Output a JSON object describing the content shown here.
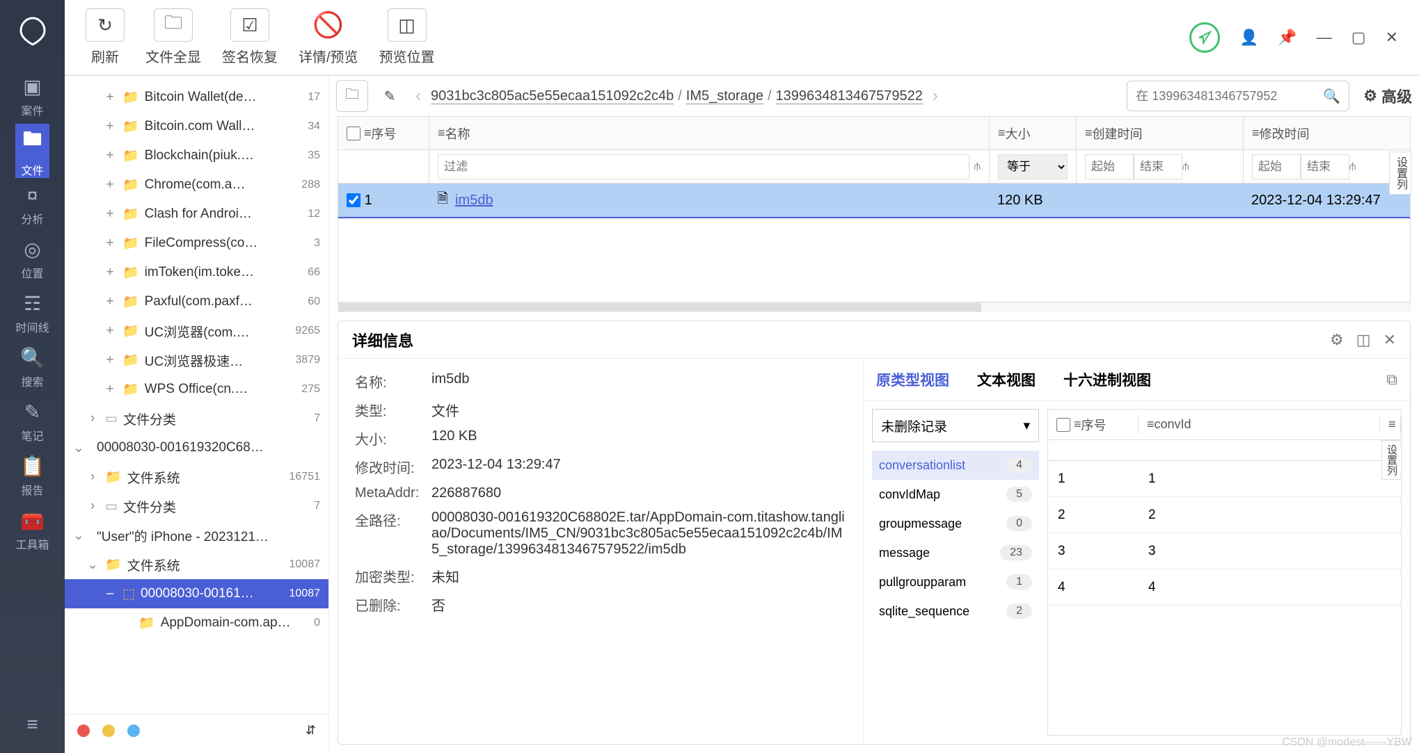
{
  "leftNav": {
    "items": [
      {
        "icon": "▣",
        "label": "案件"
      },
      {
        "icon": "🖿",
        "label": "文件"
      },
      {
        "icon": "¤",
        "label": "分析"
      },
      {
        "icon": "◎",
        "label": "位置"
      },
      {
        "icon": "☶",
        "label": "时间线"
      },
      {
        "icon": "🔍",
        "label": "搜索"
      },
      {
        "icon": "✎",
        "label": "笔记"
      },
      {
        "icon": "📋",
        "label": "报告"
      },
      {
        "icon": "🧰",
        "label": "工具箱"
      }
    ],
    "activeIndex": 1
  },
  "toolbar": {
    "items": [
      {
        "icon": "↻",
        "label": "刷新"
      },
      {
        "icon": "🗀",
        "label": "文件全显"
      },
      {
        "icon": "☑",
        "label": "签名恢复"
      },
      {
        "icon": "🚫",
        "label": "详情/预览",
        "noborder": true
      },
      {
        "icon": "◫",
        "label": "预览位置"
      }
    ]
  },
  "breadcrumb": {
    "segments": [
      "9031bc3c805ac5e55ecaa151092c2c4b",
      "IM5_storage",
      "1399634813467579522"
    ],
    "searchPlaceholder": "在 139963481346757952",
    "advanced": "高级"
  },
  "tree": {
    "items": [
      {
        "lvl": 2,
        "exp": "+",
        "icon": "📁",
        "name": "Bitcoin Wallet(de…",
        "count": "17"
      },
      {
        "lvl": 2,
        "exp": "+",
        "icon": "📁",
        "name": "Bitcoin.com Wall…",
        "count": "34"
      },
      {
        "lvl": 2,
        "exp": "+",
        "icon": "📁",
        "name": "Blockchain(piuk.…",
        "count": "35"
      },
      {
        "lvl": 2,
        "exp": "+",
        "icon": "📁",
        "name": "Chrome(com.a…",
        "count": "288"
      },
      {
        "lvl": 2,
        "exp": "+",
        "icon": "📁",
        "name": "Clash for Androi…",
        "count": "12"
      },
      {
        "lvl": 2,
        "exp": "+",
        "icon": "📁",
        "name": "FileCompress(co…",
        "count": "3"
      },
      {
        "lvl": 2,
        "exp": "+",
        "icon": "📁",
        "name": "imToken(im.toke…",
        "count": "66"
      },
      {
        "lvl": 2,
        "exp": "+",
        "icon": "📁",
        "name": "Paxful(com.paxf…",
        "count": "60"
      },
      {
        "lvl": 2,
        "exp": "+",
        "icon": "📁",
        "name": "UC浏览器(com.…",
        "count": "9265"
      },
      {
        "lvl": 2,
        "exp": "+",
        "icon": "📁",
        "name": "UC浏览器极速…",
        "count": "3879"
      },
      {
        "lvl": 2,
        "exp": "+",
        "icon": "📁",
        "name": "WPS Office(cn.…",
        "count": "275"
      },
      {
        "lvl": 1,
        "exp": "›",
        "icon": "▭",
        "gray": true,
        "name": "文件分类",
        "count": "7"
      },
      {
        "lvl": 0,
        "exp": "⌄",
        "icon": "",
        "gray": true,
        "name": "00008030-001619320C68…",
        "count": ""
      },
      {
        "lvl": 1,
        "exp": "›",
        "icon": "📁",
        "name": "文件系统",
        "count": "16751"
      },
      {
        "lvl": 1,
        "exp": "›",
        "icon": "▭",
        "gray": true,
        "name": "文件分类",
        "count": "7"
      },
      {
        "lvl": 0,
        "exp": "⌄",
        "icon": "",
        "gray": true,
        "name": "\"User\"的 iPhone - 2023121…",
        "count": ""
      },
      {
        "lvl": 1,
        "exp": "⌄",
        "icon": "📁",
        "name": "文件系统",
        "count": "10087"
      },
      {
        "lvl": 2,
        "exp": "–",
        "icon": "⬚",
        "name": "00008030-00161…",
        "count": "10087",
        "selected": true
      },
      {
        "lvl": 3,
        "exp": "",
        "icon": "📁",
        "name": "AppDomain-com.ap…",
        "count": "0"
      }
    ]
  },
  "fileTable": {
    "cols": {
      "seq": "序号",
      "name": "名称",
      "size": "大小",
      "ctime": "创建时间",
      "mtime": "修改时间"
    },
    "filter": {
      "name": "过滤",
      "eq": "等于",
      "start": "起始",
      "end": "结束"
    },
    "row": {
      "seq": "1",
      "name": "im5db",
      "size": "120 KB",
      "ctime": "",
      "mtime": "2023-12-04 13:29:47"
    },
    "sideLabel": "设置列"
  },
  "details": {
    "title": "详细信息",
    "fields": [
      {
        "label": "名称:",
        "value": "im5db"
      },
      {
        "label": "类型:",
        "value": "文件"
      },
      {
        "label": "大小:",
        "value": "120 KB"
      },
      {
        "label": "修改时间:",
        "value": "2023-12-04 13:29:47"
      },
      {
        "label": "MetaAddr:",
        "value": "226887680"
      },
      {
        "label": "全路径:",
        "value": "00008030-001619320C68802E.tar/AppDomain-com.titashow.tangliao/Documents/IM5_CN/9031bc3c805ac5e55ecaa151092c2c4b/IM5_storage/1399634813467579522/im5db"
      },
      {
        "label": "加密类型:",
        "value": "未知"
      },
      {
        "label": "已删除:",
        "value": "否"
      }
    ],
    "viewTabs": {
      "raw": "原类型视图",
      "text": "文本视图",
      "hex": "十六进制视图"
    },
    "dbSelect": "未删除记录",
    "dbItems": [
      {
        "name": "conversationlist",
        "count": "4",
        "active": true
      },
      {
        "name": "convIdMap",
        "count": "5"
      },
      {
        "name": "groupmessage",
        "count": "0"
      },
      {
        "name": "message",
        "count": "23"
      },
      {
        "name": "pullgroupparam",
        "count": "1"
      },
      {
        "name": "sqlite_sequence",
        "count": "2"
      }
    ],
    "dbTable": {
      "cols": {
        "seq": "序号",
        "convId": "convId"
      },
      "rows": [
        [
          "1",
          "1"
        ],
        [
          "2",
          "2"
        ],
        [
          "3",
          "3"
        ],
        [
          "4",
          "4"
        ]
      ],
      "sideLabel": "设置列"
    }
  },
  "watermark": "CSDN @modest——YBW"
}
